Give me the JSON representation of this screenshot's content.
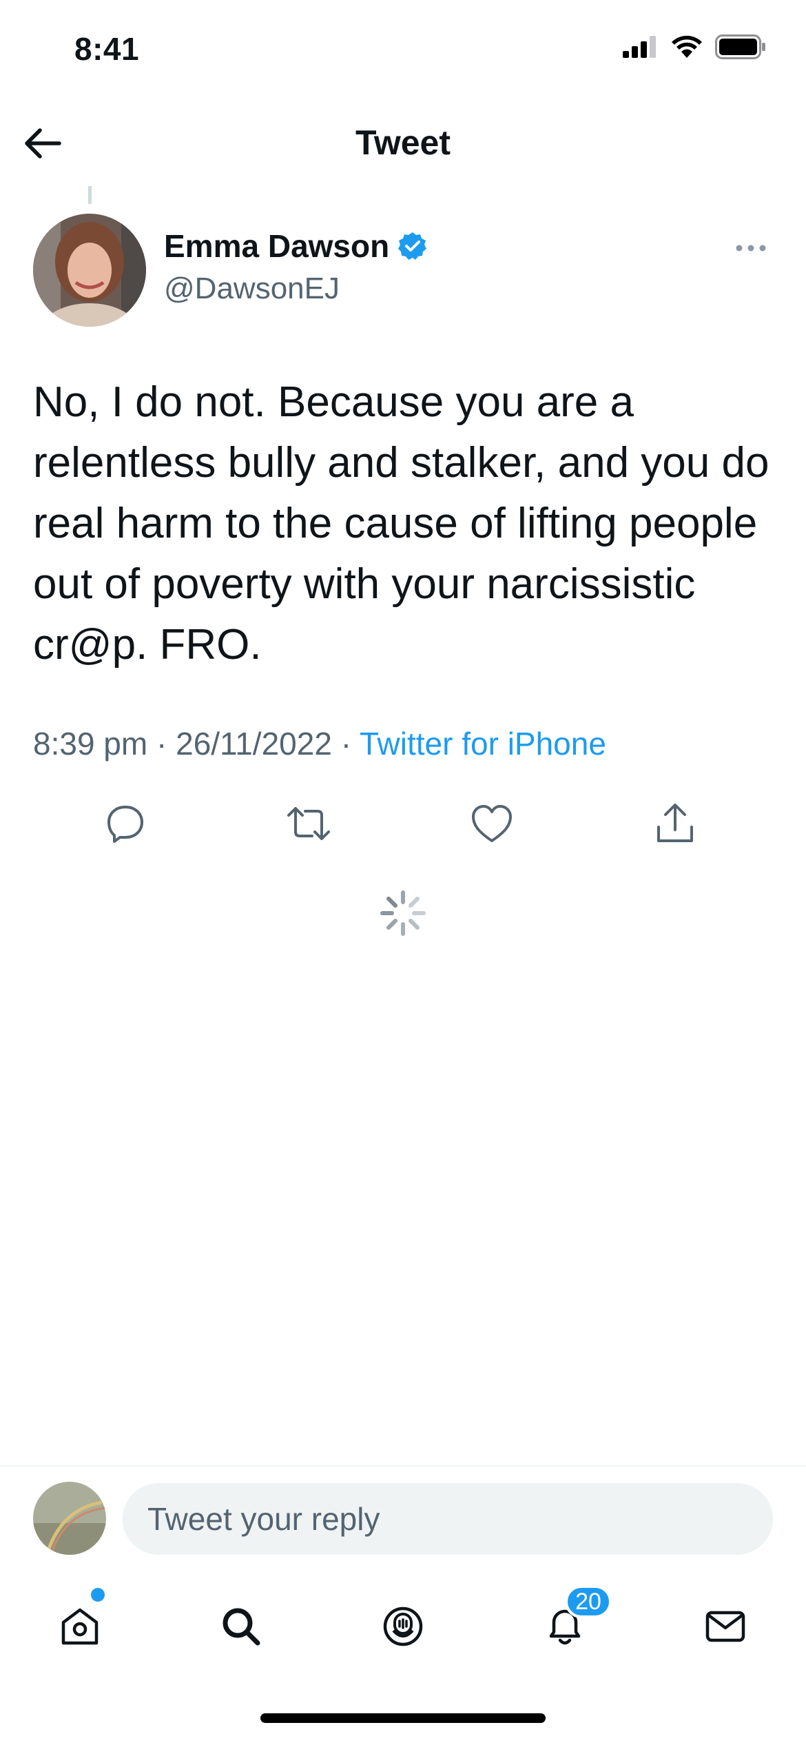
{
  "status_bar": {
    "time": "8:41"
  },
  "header": {
    "title": "Tweet"
  },
  "author": {
    "name": "Emma Dawson",
    "handle": "@DawsonEJ",
    "verified": true
  },
  "tweet": {
    "text": "No, I do not. Because you are a relentless bully and stalker, and you do real harm to the cause of lifting people out of poverty with your narcissistic cr@p. FRO.",
    "time": "8:39 pm",
    "separator": "·",
    "date": "26/11/2022",
    "source": "Twitter for iPhone"
  },
  "actions": [
    "reply-icon",
    "retweet-icon",
    "like-icon",
    "share-icon"
  ],
  "reply_box": {
    "placeholder": "Tweet your reply"
  },
  "tabbar": {
    "items": [
      "home-icon",
      "search-icon",
      "spaces-icon",
      "notifications-icon",
      "messages-icon"
    ],
    "notifications_badge": "20"
  },
  "colors": {
    "accent": "#1d9bf0",
    "text": "#0f1419",
    "secondary": "#536471"
  }
}
